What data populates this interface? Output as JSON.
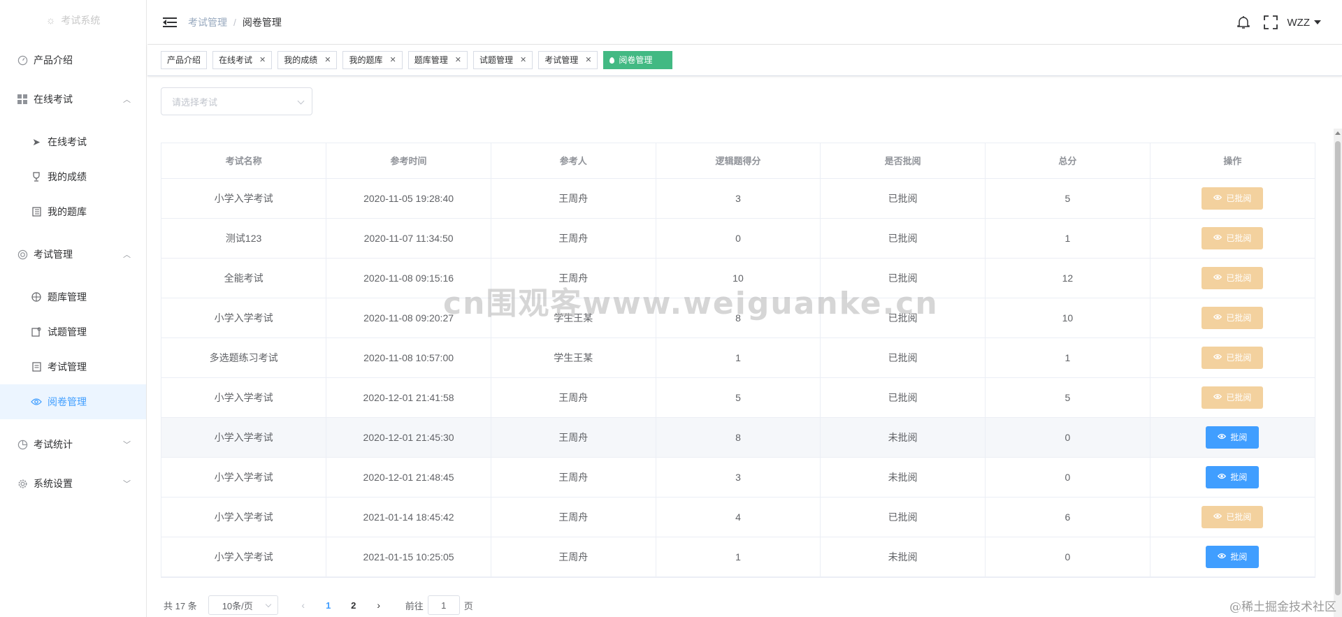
{
  "app": {
    "logo_text": "考试系统"
  },
  "sidebar": {
    "items": [
      {
        "label": "产品介绍"
      },
      {
        "label": "在线考试",
        "children": [
          {
            "label": "在线考试"
          },
          {
            "label": "我的成绩"
          },
          {
            "label": "我的题库"
          }
        ]
      },
      {
        "label": "考试管理",
        "children": [
          {
            "label": "题库管理"
          },
          {
            "label": "试题管理"
          },
          {
            "label": "考试管理"
          },
          {
            "label": "阅卷管理"
          }
        ]
      },
      {
        "label": "考试统计"
      },
      {
        "label": "系统设置"
      }
    ]
  },
  "header": {
    "breadcrumb": [
      "考试管理",
      "阅卷管理"
    ],
    "breadcrumb_sep": "/",
    "user": "WZZ"
  },
  "tags": [
    {
      "label": "产品介绍"
    },
    {
      "label": "在线考试"
    },
    {
      "label": "我的成绩"
    },
    {
      "label": "我的题库"
    },
    {
      "label": "题库管理"
    },
    {
      "label": "试题管理"
    },
    {
      "label": "考试管理"
    },
    {
      "label": "阅卷管理"
    }
  ],
  "filter": {
    "placeholder": "请选择考试"
  },
  "table": {
    "columns": [
      "考试名称",
      "参考时间",
      "参考人",
      "逻辑题得分",
      "是否批阅",
      "总分",
      "操作"
    ],
    "rows": [
      [
        "小学入学考试",
        "2020-11-05 19:28:40",
        "王周舟",
        "3",
        "已批阅",
        "5",
        "已批阅"
      ],
      [
        "测试123",
        "2020-11-07 11:34:50",
        "王周舟",
        "0",
        "已批阅",
        "1",
        "已批阅"
      ],
      [
        "全能考试",
        "2020-11-08 09:15:16",
        "王周舟",
        "10",
        "已批阅",
        "12",
        "已批阅"
      ],
      [
        "小学入学考试",
        "2020-11-08 09:20:27",
        "学生王某",
        "8",
        "已批阅",
        "10",
        "已批阅"
      ],
      [
        "多选题练习考试",
        "2020-11-08 10:57:00",
        "学生王某",
        "1",
        "已批阅",
        "1",
        "已批阅"
      ],
      [
        "小学入学考试",
        "2020-12-01 21:41:58",
        "王周舟",
        "5",
        "已批阅",
        "5",
        "已批阅"
      ],
      [
        "小学入学考试",
        "2020-12-01 21:45:30",
        "王周舟",
        "8",
        "未批阅",
        "0",
        "批阅"
      ],
      [
        "小学入学考试",
        "2020-12-01 21:48:45",
        "王周舟",
        "3",
        "未批阅",
        "0",
        "批阅"
      ],
      [
        "小学入学考试",
        "2021-01-14 18:45:42",
        "王周舟",
        "4",
        "已批阅",
        "6",
        "已批阅"
      ],
      [
        "小学入学考试",
        "2021-01-15 10:25:05",
        "王周舟",
        "1",
        "未批阅",
        "0",
        "批阅"
      ]
    ]
  },
  "pagination": {
    "total": "共 17 条",
    "page_size": "10条/页",
    "pages": [
      "1",
      "2"
    ],
    "goto_prefix": "前往",
    "goto_value": "1",
    "goto_suffix": "页"
  },
  "overlay": {
    "watermark": "cn围观客www.weiguanke.cn",
    "corner": "@稀土掘金技术社区"
  },
  "colors": {
    "accent": "#409eff",
    "active_tag": "#42b983",
    "reviewed_button": "#f3d19e"
  }
}
